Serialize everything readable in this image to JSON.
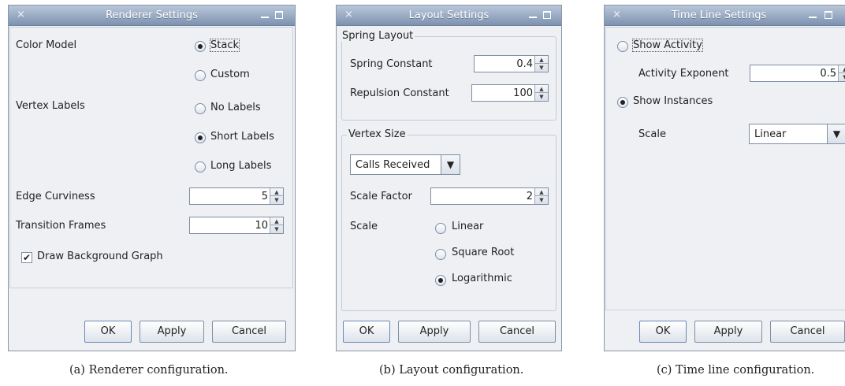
{
  "renderer": {
    "title": "Renderer Settings",
    "close_glyph": "×",
    "color_model_label": "Color Model",
    "color_stack": "Stack",
    "color_custom": "Custom",
    "vertex_labels_label": "Vertex Labels",
    "vl_no": "No Labels",
    "vl_short": "Short Labels",
    "vl_long": "Long Labels",
    "edge_curviness_label": "Edge Curviness",
    "edge_curviness_value": "5",
    "transition_frames_label": "Transition Frames",
    "transition_frames_value": "10",
    "draw_background_label": "Draw Background Graph",
    "check_glyph": "✔",
    "ok": "OK",
    "apply": "Apply",
    "cancel": "Cancel",
    "caption": "(a) Renderer configuration."
  },
  "layout": {
    "title": "Layout Settings",
    "close_glyph": "×",
    "spring_group": "Spring Layout",
    "spring_constant_label": "Spring Constant",
    "spring_constant_value": "0.4",
    "repulsion_label": "Repulsion Constant",
    "repulsion_value": "100",
    "vertex_size_group": "Vertex Size",
    "vertex_size_combo": "Calls Received",
    "scale_factor_label": "Scale Factor",
    "scale_factor_value": "2",
    "scale_label": "Scale",
    "scale_linear": "Linear",
    "scale_sqrt": "Square Root",
    "scale_log": "Logarithmic",
    "ok": "OK",
    "apply": "Apply",
    "cancel": "Cancel",
    "caption": "(b) Layout configuration."
  },
  "timeline": {
    "title": "Time Line Settings",
    "close_glyph": "×",
    "show_activity": "Show Activity",
    "activity_exponent_label": "Activity Exponent",
    "activity_exponent_value": "0.5",
    "show_instances": "Show Instances",
    "scale_label": "Scale",
    "scale_combo": "Linear",
    "ok": "OK",
    "apply": "Apply",
    "cancel": "Cancel",
    "caption": "(c) Time line configuration."
  },
  "glyphs": {
    "spin_up": "▲",
    "spin_down": "▼",
    "combo_arrow": "▼"
  },
  "colors": {
    "titlebar_top": "#b9c7da",
    "titlebar_bottom": "#7d92b0",
    "dialog_bg": "#eef0f4"
  }
}
